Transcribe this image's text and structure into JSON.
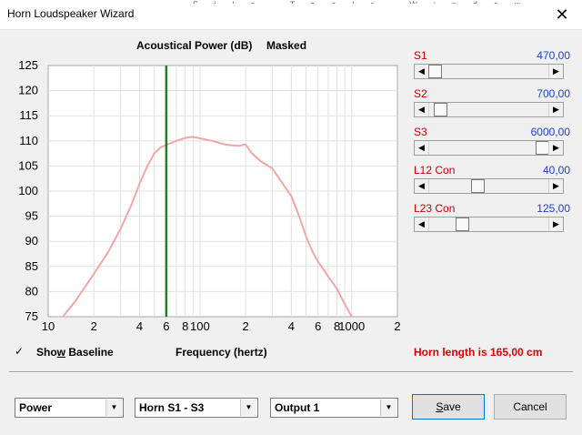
{
  "window": {
    "title": "Horn Loudspeaker Wizard",
    "close_glyph": "✕",
    "ghost_menu": "File  Tools  Window  Help"
  },
  "chart_header": {
    "left": "Acoustical Power (dB)",
    "right": "Masked"
  },
  "chart_data": {
    "type": "line",
    "title": "Acoustical Power (dB)",
    "xlabel": "Frequency (hertz)",
    "ylabel": "",
    "x_scale": "log",
    "xlim": [
      10,
      2000
    ],
    "ylim": [
      75,
      125
    ],
    "grid": true,
    "y_ticks": [
      75,
      80,
      85,
      90,
      95,
      100,
      105,
      110,
      115,
      120,
      125
    ],
    "x_tick_labels": [
      {
        "v": 10,
        "t": "10"
      },
      {
        "v": 20,
        "t": "2"
      },
      {
        "v": 40,
        "t": "4"
      },
      {
        "v": 60,
        "t": "6"
      },
      {
        "v": 80,
        "t": "8"
      },
      {
        "v": 100,
        "t": "100"
      },
      {
        "v": 200,
        "t": "2"
      },
      {
        "v": 400,
        "t": "4"
      },
      {
        "v": 600,
        "t": "6"
      },
      {
        "v": 800,
        "t": "8"
      },
      {
        "v": 1000,
        "t": "1000"
      },
      {
        "v": 2000,
        "t": "2"
      }
    ],
    "marker_x": 60,
    "series": [
      {
        "color": "#f4a6a6",
        "x": [
          12.5,
          15,
          20,
          25,
          30,
          35,
          40,
          45,
          50,
          55,
          60,
          70,
          80,
          90,
          100,
          120,
          150,
          180,
          200,
          220,
          250,
          300,
          350,
          400,
          450,
          500,
          550,
          600,
          700,
          800,
          900,
          1000
        ],
        "y": [
          75,
          78,
          83.5,
          88,
          92.5,
          97,
          101.5,
          105,
          107.5,
          108.7,
          109.2,
          110,
          110.6,
          110.8,
          110.5,
          110,
          109.2,
          109,
          109.3,
          107.5,
          106,
          104.5,
          101.5,
          99,
          95,
          91,
          88,
          86,
          83,
          80.5,
          77.5,
          75
        ]
      }
    ]
  },
  "sliders": [
    {
      "label": "S1",
      "value": "470,00",
      "level": 0.0
    },
    {
      "label": "S2",
      "value": "700,00",
      "level": 0.05
    },
    {
      "label": "S3",
      "value": "6000,00",
      "level": 1.0
    },
    {
      "label": "L12  Con",
      "value": "40,00",
      "level": 0.4
    },
    {
      "label": "L23  Con",
      "value": "125,00",
      "level": 0.25
    }
  ],
  "footer": {
    "checkbox_mark": "✓",
    "show_baseline_pre": "Sho",
    "show_baseline_u": "w",
    "show_baseline_post": " Baseline",
    "show_baseline_checked": true,
    "frequency_label": "Frequency (hertz)",
    "horn_length": "Horn length is 165,00 cm"
  },
  "controls": {
    "combo1": "Power",
    "combo2": "Horn S1 - S3",
    "combo3": "Output 1",
    "save_u": "S",
    "save_rest": "ave",
    "cancel": "Cancel"
  }
}
